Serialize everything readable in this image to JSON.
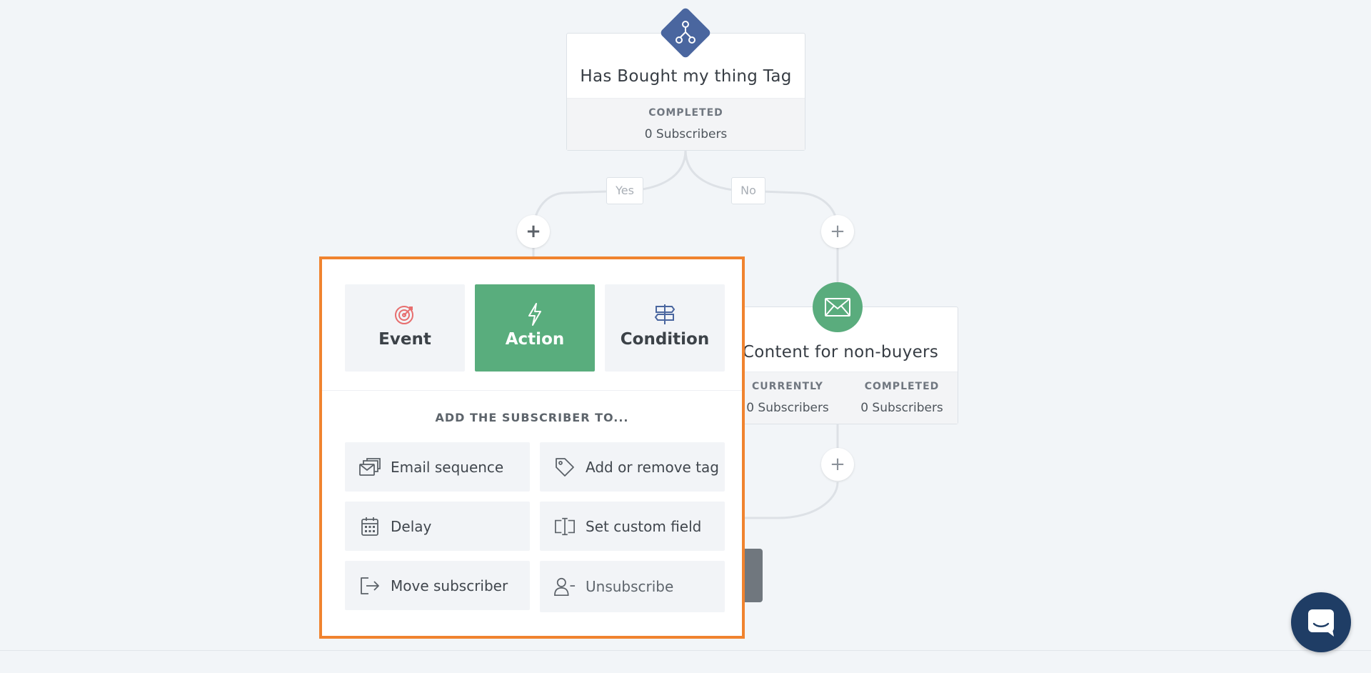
{
  "tag_node": {
    "icon": "branch-icon",
    "title": "Has Bought my thing Tag",
    "completed_label": "COMPLETED",
    "completed_value": "0 Subscribers",
    "accent_color": "#4a669f"
  },
  "branches": {
    "yes_label": "Yes",
    "no_label": "No",
    "add_symbol": "+"
  },
  "email_node": {
    "icon": "envelope-icon",
    "title": "Content for non-buyers",
    "currently_label": "CURRENTLY",
    "currently_value": "0 Subscribers",
    "completed_label": "COMPLETED",
    "completed_value": "0 Subscribers",
    "accent_color": "#5aac7d"
  },
  "panel": {
    "border_color": "#f0832f",
    "tabs": [
      {
        "label": "Event",
        "icon": "target-icon",
        "active": false
      },
      {
        "label": "Action",
        "icon": "lightning-icon",
        "active": true
      },
      {
        "label": "Condition",
        "icon": "signpost-icon",
        "active": false
      }
    ],
    "heading": "ADD THE SUBSCRIBER TO...",
    "options": [
      {
        "label": "Email sequence",
        "icon": "email-sequence-icon"
      },
      {
        "label": "Add or remove tag",
        "icon": "tag-icon"
      },
      {
        "label": "Delay",
        "icon": "calendar-icon"
      },
      {
        "label": "Set custom field",
        "icon": "text-cursor-icon"
      },
      {
        "label": "Move subscriber",
        "icon": "exit-arrow-icon"
      },
      {
        "label": "Unsubscribe",
        "icon": "user-minus-icon"
      }
    ]
  },
  "chat_widget": {
    "icon": "chat-icon",
    "color": "#1f3d65"
  }
}
